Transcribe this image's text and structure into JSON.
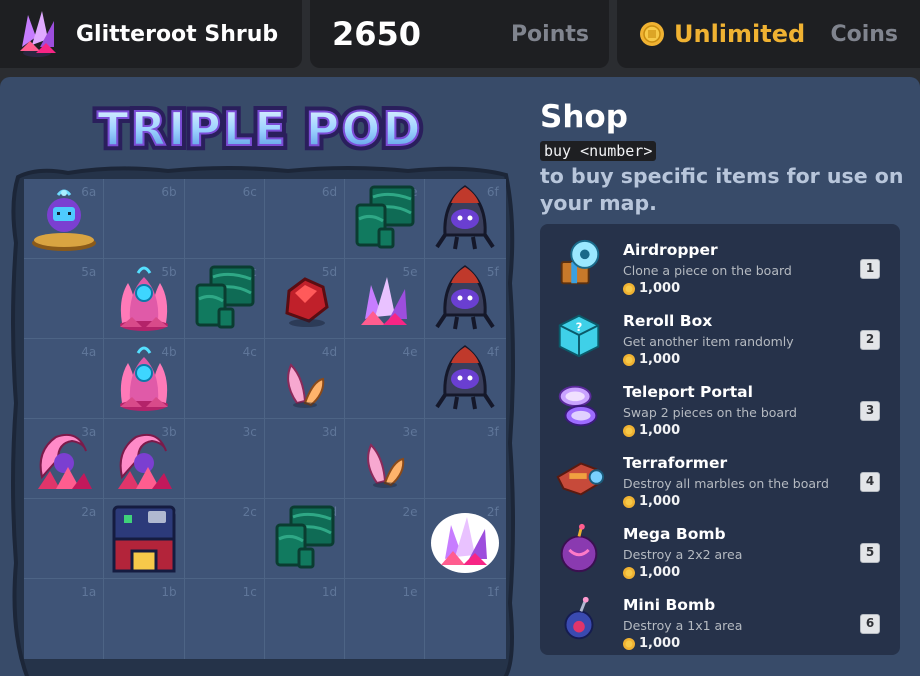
{
  "header": {
    "player_name": "Glitteroot Shrub",
    "score": "2650",
    "score_label": "Points",
    "coins_value": "Unlimited",
    "coins_label": "Coins"
  },
  "game": {
    "title": "TRIPLE POD"
  },
  "board": {
    "rows": [
      [
        "6a",
        "6b",
        "6c",
        "6d",
        "6e",
        "6f"
      ],
      [
        "5a",
        "5b",
        "5c",
        "5d",
        "5e",
        "5f"
      ],
      [
        "4a",
        "4b",
        "4c",
        "4d",
        "4e",
        "4f"
      ],
      [
        "3a",
        "3b",
        "3c",
        "3d",
        "3e",
        "3f"
      ],
      [
        "2a",
        "2b",
        "2c",
        "2d",
        "2e",
        "2f"
      ],
      [
        "1a",
        "1b",
        "1c",
        "1d",
        "1e",
        "1f"
      ]
    ],
    "pieces": {
      "6a": "robot-pod-pedestal",
      "6e": "marble-tiles",
      "6f": "rocket-pod",
      "5b": "crystal-fountain",
      "5c": "marble-tiles",
      "5d": "red-gem",
      "5e": "crystal-shrub",
      "5f": "rocket-pod",
      "4b": "crystal-fountain",
      "4d": "small-sprout",
      "4f": "rocket-pod",
      "3a": "crystal-bush",
      "3b": "crystal-bush",
      "3e": "small-sprout",
      "2b": "storage-house",
      "2d": "marble-tiles",
      "2f": "crystal-shrub-selected"
    }
  },
  "shop": {
    "title": "Shop",
    "command": "buy <number>",
    "description": "to buy specific items for use on your map.",
    "items": [
      {
        "name": "Airdropper",
        "description": "Clone a piece on the board",
        "price": "1,000",
        "number": "1",
        "icon": "airdropper-icon"
      },
      {
        "name": "Reroll Box",
        "description": "Get another item randomly",
        "price": "1,000",
        "number": "2",
        "icon": "reroll-box-icon"
      },
      {
        "name": "Teleport Portal",
        "description": "Swap 2 pieces on the board",
        "price": "1,000",
        "number": "3",
        "icon": "teleport-portal-icon"
      },
      {
        "name": "Terraformer",
        "description": "Destroy all marbles on the board",
        "price": "1,000",
        "number": "4",
        "icon": "terraformer-icon"
      },
      {
        "name": "Mega Bomb",
        "description": "Destroy a 2x2 area",
        "price": "1,000",
        "number": "5",
        "icon": "mega-bomb-icon"
      },
      {
        "name": "Mini Bomb",
        "description": "Destroy a 1x1 area",
        "price": "1,000",
        "number": "6",
        "icon": "mini-bomb-icon"
      }
    ]
  },
  "colors": {
    "accent_gold": "#f0b232",
    "board_bg": "#3f5477",
    "panel_bg": "#1e1f22"
  }
}
